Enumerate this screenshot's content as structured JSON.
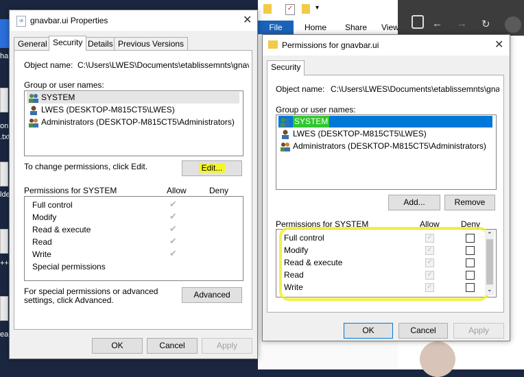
{
  "desktop": {
    "icon_labels": [
      "har",
      "on",
      ".txt",
      "lde",
      "++",
      "eau"
    ]
  },
  "explorer": {
    "tabs": [
      "File",
      "Home",
      "Share",
      "View"
    ]
  },
  "props": {
    "title": "gnavbar.ui Properties",
    "tabs": [
      "General",
      "Security",
      "Details",
      "Previous Versions"
    ],
    "object_label": "Object name:",
    "object_value": "C:\\Users\\LWES\\Documents\\etablissemnts\\gnavb",
    "group_label": "Group or user names:",
    "users": [
      "SYSTEM",
      "LWES (DESKTOP-M815CT5\\LWES)",
      "Administrators (DESKTOP-M815CT5\\Administrators)"
    ],
    "change_text": "To change permissions, click Edit.",
    "edit_label": "Edit...",
    "perm_header": "Permissions for SYSTEM",
    "allow": "Allow",
    "deny": "Deny",
    "perms": [
      "Full control",
      "Modify",
      "Read & execute",
      "Read",
      "Write",
      "Special permissions"
    ],
    "special_text": "For special permissions or advanced settings, click Advanced.",
    "advanced_label": "Advanced",
    "ok": "OK",
    "cancel": "Cancel",
    "apply": "Apply"
  },
  "perm_dialog": {
    "title": "Permissions for gnavbar.ui",
    "tab": "Security",
    "object_label": "Object name:",
    "object_value": "C:\\Users\\LWES\\Documents\\etablissemnts\\gnavb",
    "group_label": "Group or user names:",
    "users": [
      "SYSTEM",
      "LWES (DESKTOP-M815CT5\\LWES)",
      "Administrators (DESKTOP-M815CT5\\Administrators)"
    ],
    "add": "Add...",
    "remove": "Remove",
    "perm_header": "Permissions for SYSTEM",
    "allow": "Allow",
    "deny": "Deny",
    "perms": [
      "Full control",
      "Modify",
      "Read & execute",
      "Read",
      "Write"
    ],
    "ok": "OK",
    "cancel": "Cancel",
    "apply": "Apply"
  },
  "colors": {
    "highlight": "#f5f52a",
    "selection": "#0078d7"
  }
}
